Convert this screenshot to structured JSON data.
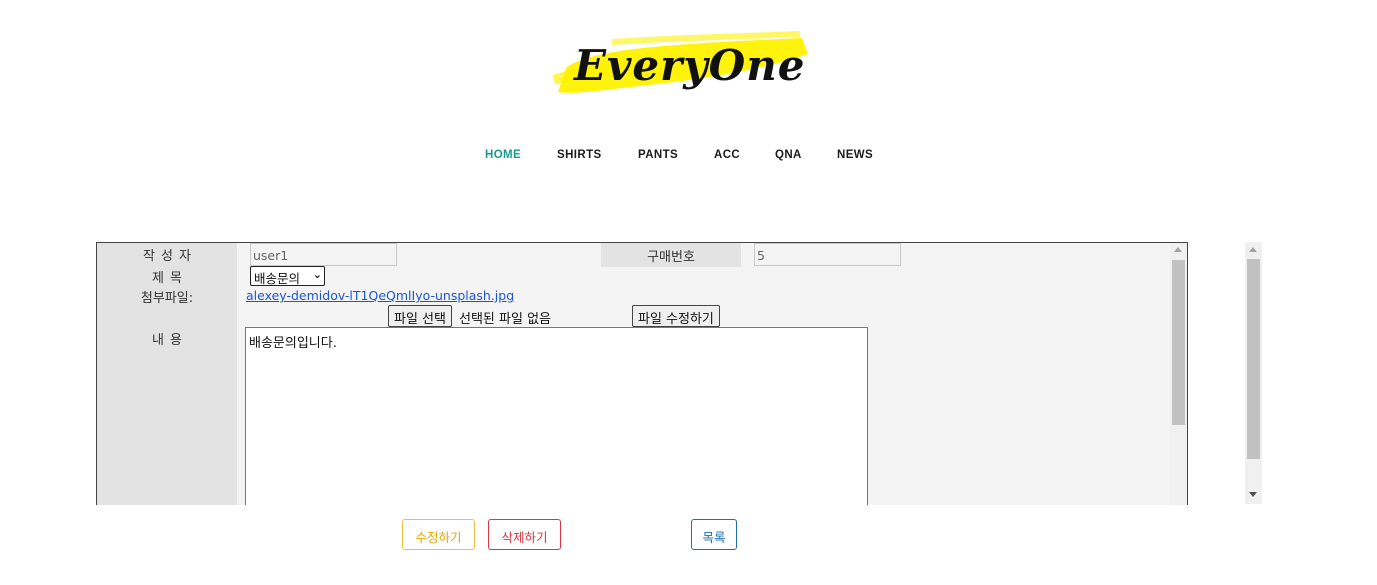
{
  "brand": {
    "logo_text": "EveryOne",
    "highlight_color": "#fff200"
  },
  "nav": {
    "items": [
      {
        "label": "HOME",
        "active": true
      },
      {
        "label": "SHIRTS",
        "active": false
      },
      {
        "label": "PANTS",
        "active": false
      },
      {
        "label": "ACC",
        "active": false
      },
      {
        "label": "QNA",
        "active": false
      },
      {
        "label": "NEWS",
        "active": false
      }
    ],
    "active_color": "#1a9a8e"
  },
  "form": {
    "writer_label": "작성자",
    "writer_value": "user1",
    "order_label": "구매번호",
    "order_value": "5",
    "title_label": "제목",
    "title_selected": "배송문의",
    "attachment_label": "첨부파일:",
    "attachment_file": "alexey-demidov-lT1QeQmlIyo-unsplash.jpg",
    "choose_file_button": "파일 선택",
    "no_file_text": "선택된 파일 없음",
    "edit_file_button": "파일 수정하기",
    "content_label": "내용",
    "content_value": "배송문의입니다."
  },
  "actions": {
    "edit": "수정하기",
    "delete": "삭제하기",
    "list": "목록"
  }
}
